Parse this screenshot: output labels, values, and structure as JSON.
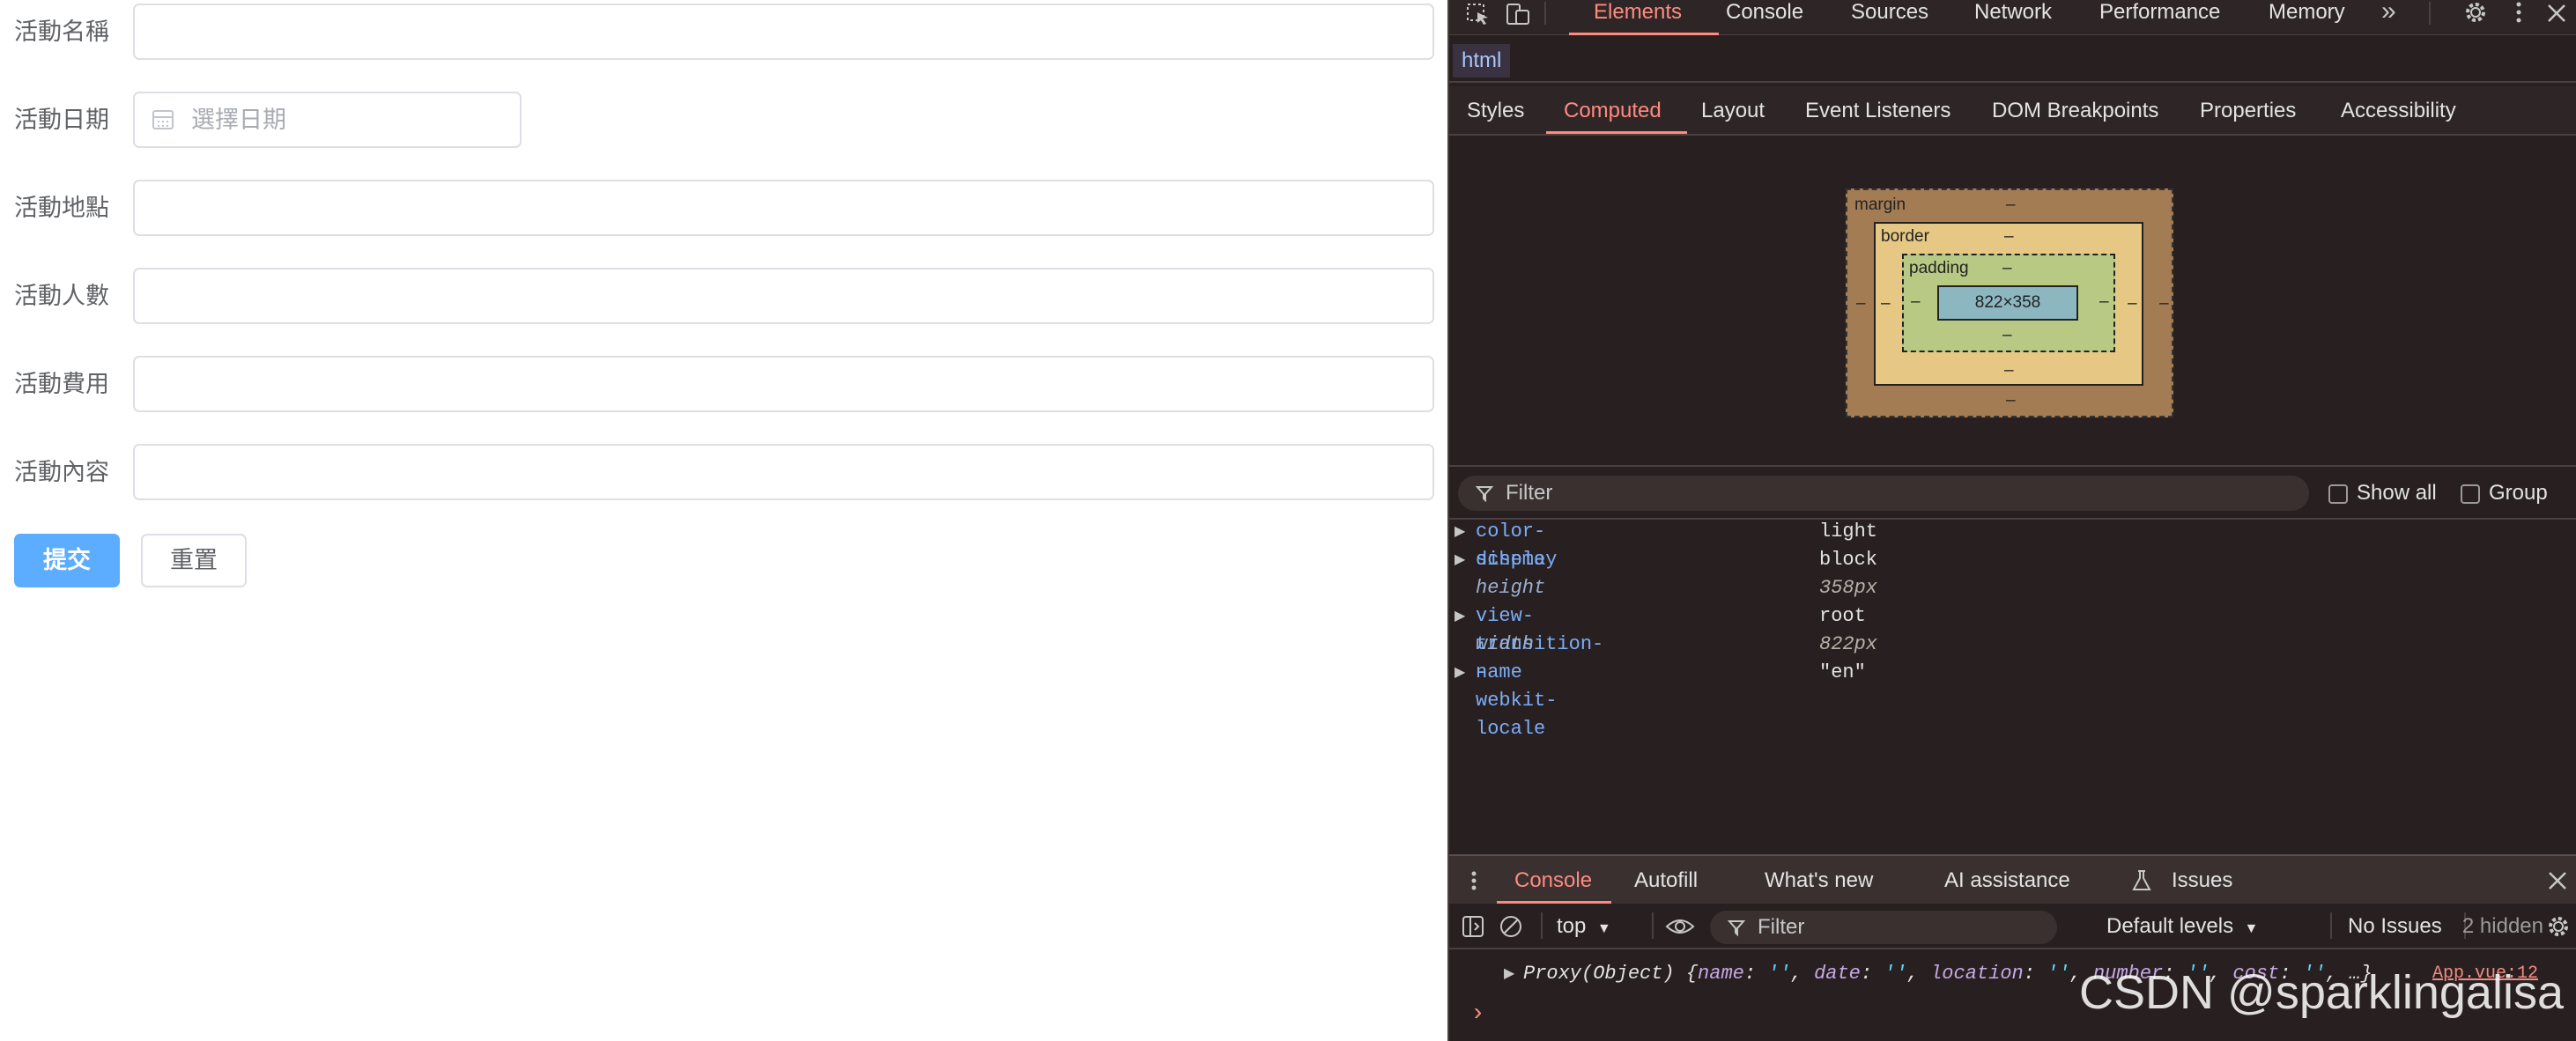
{
  "form": {
    "fields": [
      {
        "label": "活動名稱"
      },
      {
        "label": "活動日期",
        "placeholder": "選擇日期"
      },
      {
        "label": "活動地點"
      },
      {
        "label": "活動人數"
      },
      {
        "label": "活動費用"
      },
      {
        "label": "活動內容"
      }
    ],
    "submit_label": "提交",
    "reset_label": "重置"
  },
  "devtools": {
    "main_tabs": [
      "Elements",
      "Console",
      "Sources",
      "Network",
      "Performance",
      "Memory"
    ],
    "active_main_tab": "Elements",
    "overflow_label": "»",
    "breadcrumb": "html",
    "sub_tabs": [
      "Styles",
      "Computed",
      "Layout",
      "Event Listeners",
      "DOM Breakpoints",
      "Properties",
      "Accessibility"
    ],
    "active_sub_tab": "Computed",
    "box_model": {
      "margin_label": "margin",
      "border_label": "border",
      "padding_label": "padding",
      "content_size": "822×358",
      "dash": "–"
    },
    "filter_placeholder": "Filter",
    "show_all_label": "Show all",
    "group_label": "Group",
    "properties": [
      {
        "name": "color-scheme",
        "value": "light",
        "inherited": false,
        "expandable": true
      },
      {
        "name": "display",
        "value": "block",
        "inherited": false,
        "expandable": true
      },
      {
        "name": "height",
        "value": "358px",
        "inherited": true,
        "expandable": false
      },
      {
        "name": "view-transition-name",
        "value": "root",
        "inherited": false,
        "expandable": true
      },
      {
        "name": "width",
        "value": "822px",
        "inherited": true,
        "expandable": false
      },
      {
        "name": "-webkit-locale",
        "value": "\"en\"",
        "inherited": false,
        "expandable": true
      }
    ],
    "drawer_tabs": [
      "Console",
      "Autofill",
      "What's new",
      "AI assistance",
      "Issues"
    ],
    "active_drawer_tab": "Console",
    "console_toolbar": {
      "context": "top",
      "filter_placeholder": "Filter",
      "levels": "Default levels",
      "issues": "No Issues",
      "hidden": "2 hidden"
    },
    "console_log": {
      "prefix": "Proxy(Object) {",
      "entries": [
        {
          "key": "name",
          "val": "''"
        },
        {
          "key": "date",
          "val": "''"
        },
        {
          "key": "location",
          "val": "''"
        },
        {
          "key": "number",
          "val": "''"
        },
        {
          "key": "cost",
          "val": "''"
        }
      ],
      "suffix": "…}",
      "source": "App.vue:12",
      "prompt": "›"
    }
  },
  "watermark": "CSDN @sparklingalisa",
  "colors": {
    "primary": "#409eff",
    "devtools_bg": "#282020",
    "devtools_accent": "#ff8a80",
    "prop_name": "#7cacf8"
  }
}
